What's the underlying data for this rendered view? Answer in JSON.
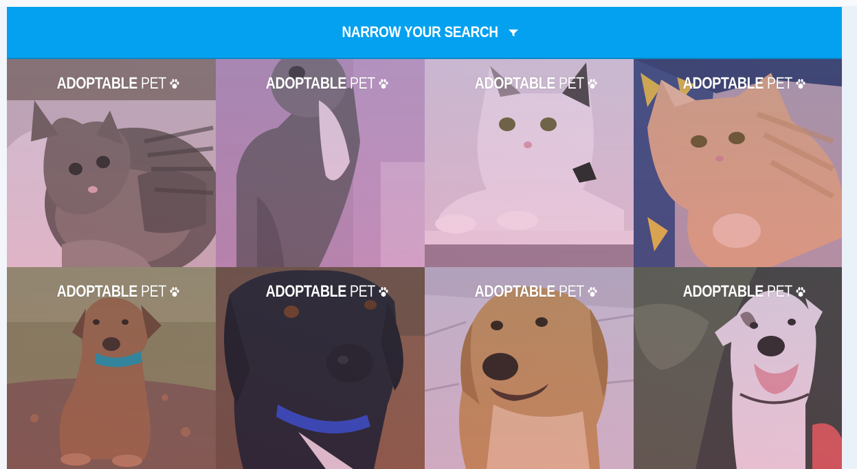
{
  "search": {
    "label": "NARROW YOUR SEARCH",
    "icon": "filter-icon"
  },
  "colors": {
    "accent": "#03a1f0",
    "caption": "#ffffff"
  },
  "pets": [
    {
      "title_strong": "ADOPTABLE",
      "title_light": "PET",
      "icon": "paw-icon",
      "kind": "tabby kitten"
    },
    {
      "title_strong": "ADOPTABLE",
      "title_light": "PET",
      "icon": "paw-icon",
      "kind": "grey and white cat"
    },
    {
      "title_strong": "ADOPTABLE",
      "title_light": "PET",
      "icon": "paw-icon",
      "kind": "white cat"
    },
    {
      "title_strong": "ADOPTABLE",
      "title_light": "PET",
      "icon": "paw-icon",
      "kind": "orange tabby cat"
    },
    {
      "title_strong": "ADOPTABLE",
      "title_light": "PET",
      "icon": "paw-icon",
      "kind": "puppy with teal collar"
    },
    {
      "title_strong": "ADOPTABLE",
      "title_light": "PET",
      "icon": "paw-icon",
      "kind": "black dog with blue collar"
    },
    {
      "title_strong": "ADOPTABLE",
      "title_light": "PET",
      "icon": "paw-icon",
      "kind": "golden dog"
    },
    {
      "title_strong": "ADOPTABLE",
      "title_light": "PET",
      "icon": "paw-icon",
      "kind": "white pit bull"
    }
  ]
}
